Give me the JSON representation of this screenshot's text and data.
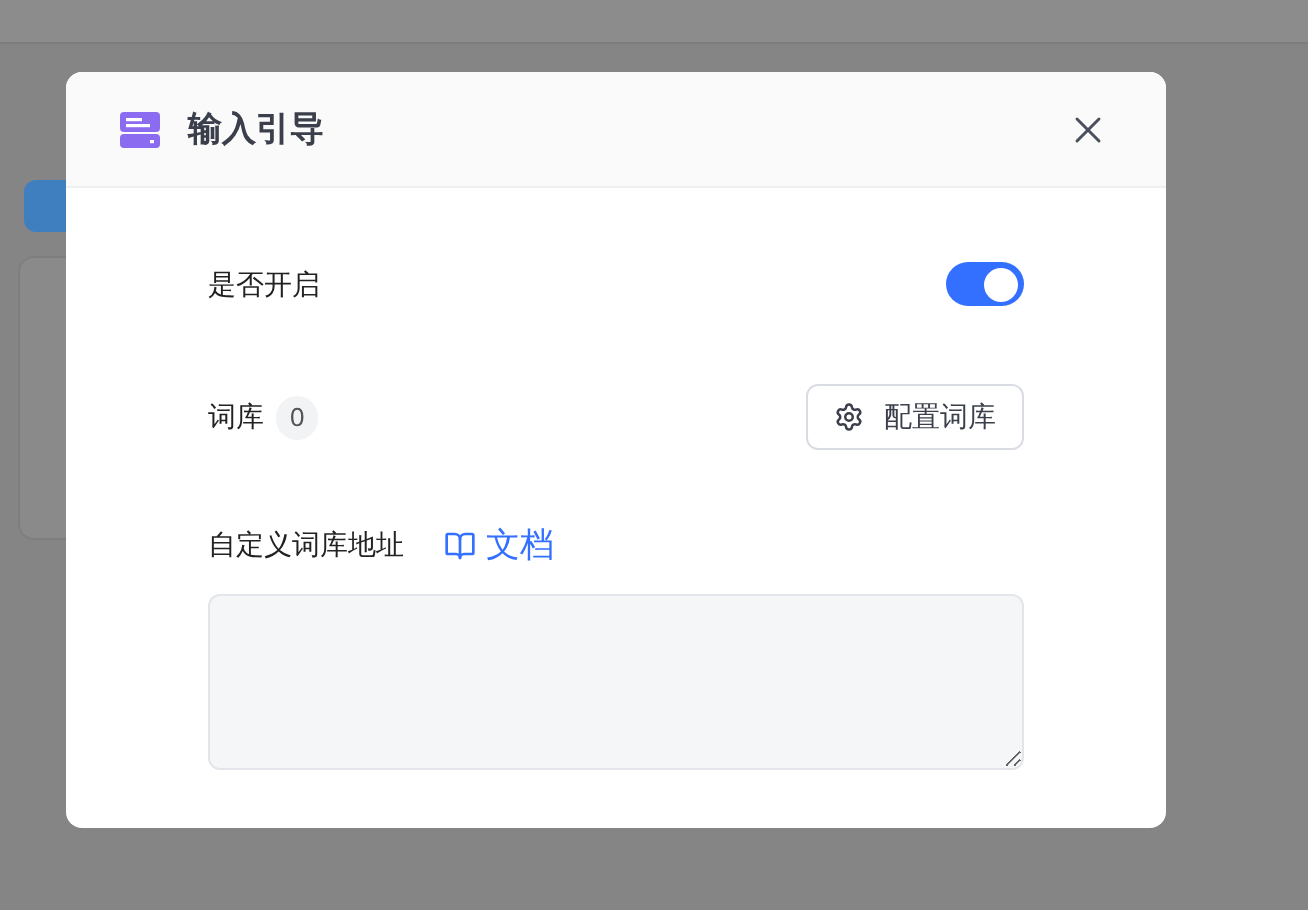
{
  "dialog": {
    "title": "输入引导",
    "enable": {
      "label": "是否开启",
      "on": true
    },
    "lexicon": {
      "label": "词库",
      "count": "0",
      "button": "配置词库"
    },
    "custom_url": {
      "label": "自定义词库地址",
      "doc_link": "文档"
    }
  }
}
